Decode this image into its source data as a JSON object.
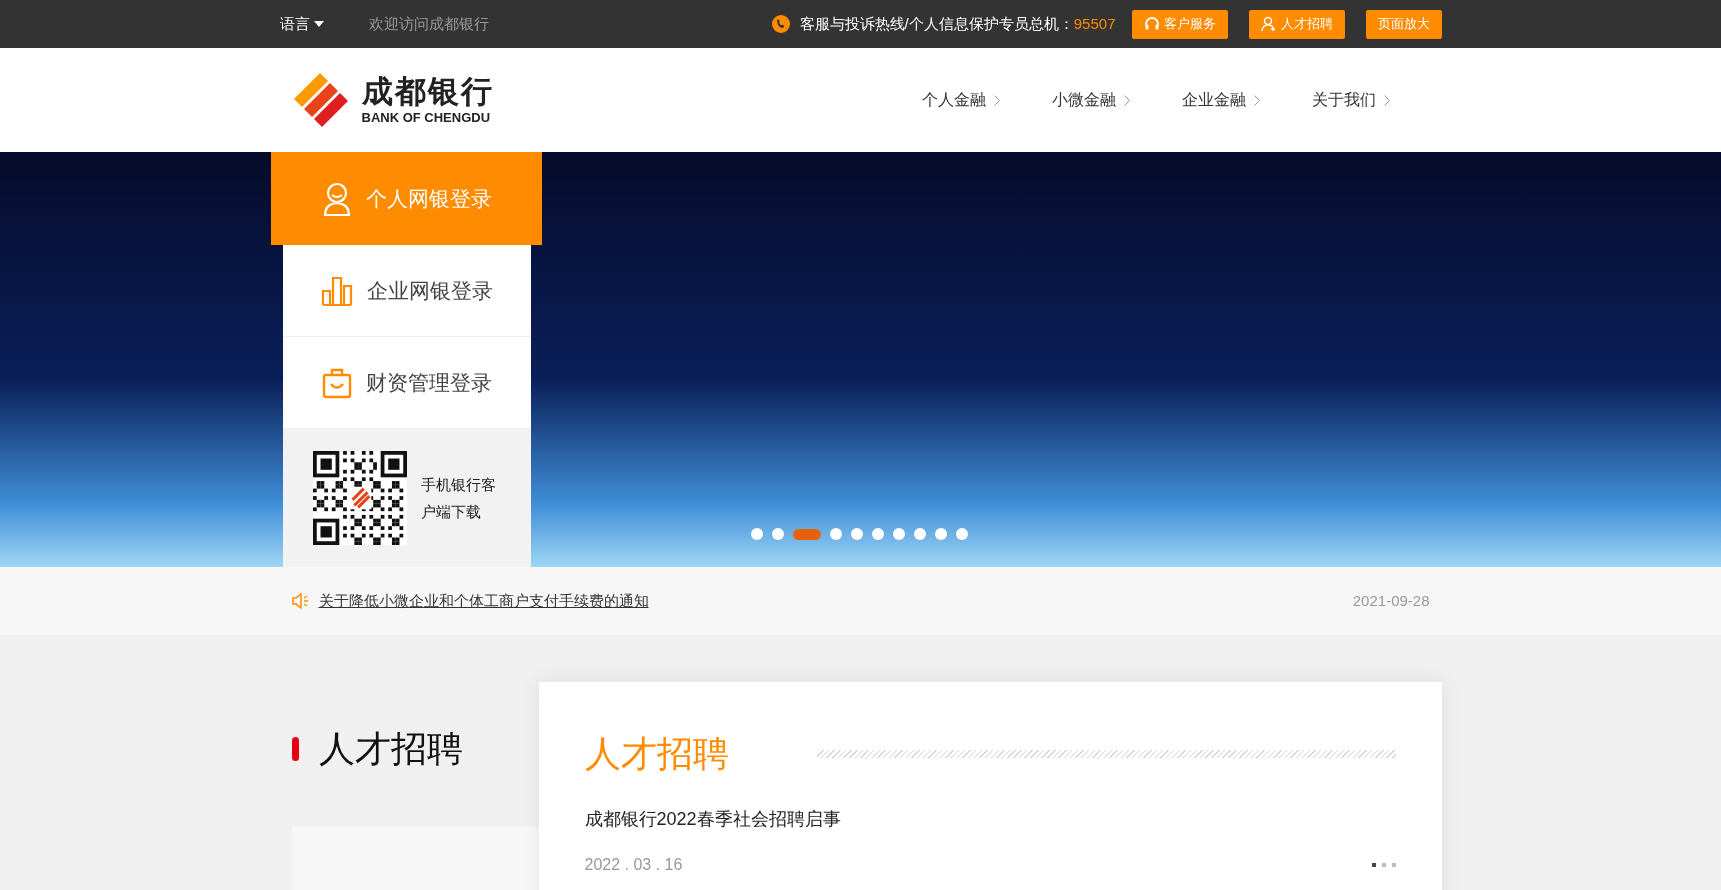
{
  "top_bar": {
    "language": "语言",
    "welcome": "欢迎访问成都银行",
    "hotline_label": "客服与投诉热线/个人信息保护专员总机：",
    "hotline_number": "95507",
    "buttons": [
      "客户服务",
      "人才招聘",
      "页面放大"
    ]
  },
  "header": {
    "logo_name": "成都银行",
    "logo_subtitle": "BANK OF CHENGDU",
    "nav": [
      "个人金融",
      "小微金融",
      "企业金融",
      "关于我们"
    ]
  },
  "login_menu": [
    {
      "label": "个人网银登录",
      "selected": true
    },
    {
      "label": "企业网银登录",
      "selected": false
    },
    {
      "label": "财资管理登录",
      "selected": false
    }
  ],
  "app_download": {
    "label": "手机银行客户端下载"
  },
  "carousel": {
    "dots": [
      {
        "selected": false
      },
      {
        "selected": false
      },
      {
        "selected": true
      },
      {
        "selected": false
      },
      {
        "selected": false
      },
      {
        "selected": false
      },
      {
        "selected": false
      },
      {
        "selected": false
      },
      {
        "selected": false
      },
      {
        "selected": false
      }
    ]
  },
  "notice": {
    "title": "关于降低小微企业和个体工商户支付手续费的通知",
    "date": "2021-09-28"
  },
  "recruitment": {
    "section_title": "人才招聘",
    "card_title": "人才招聘",
    "item_title": "成都银行2022春季社会招聘启事",
    "item_date": "2022 . 03 . 16",
    "pager": [
      {
        "selected": true
      },
      {
        "selected": false
      },
      {
        "selected": false
      }
    ]
  }
}
